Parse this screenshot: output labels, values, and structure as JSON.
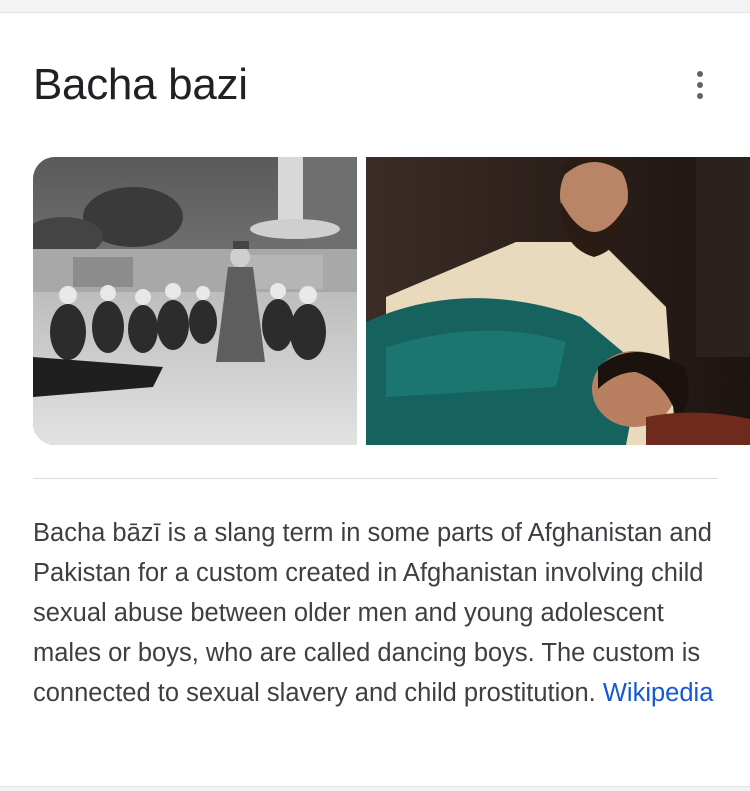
{
  "panel": {
    "title": "Bacha bazi",
    "menu_icon": "more-vert-icon"
  },
  "images": [
    {
      "name": "historical-photo",
      "tone": "black-and-white"
    },
    {
      "name": "film-still",
      "tone": "color"
    }
  ],
  "description": {
    "text": "Bacha bāzī is a slang term in some parts of Afghanistan and Pakistan for a custom created in Afghanistan involving child sexual abuse between older men and young adolescent males or boys, who are called dancing boys. The custom is connected to sexual slavery and child prostitution.",
    "source_label": "Wikipedia"
  },
  "colors": {
    "title": "#202124",
    "body_text": "#3c4043",
    "link": "#1558d6",
    "divider": "#dadce0"
  }
}
